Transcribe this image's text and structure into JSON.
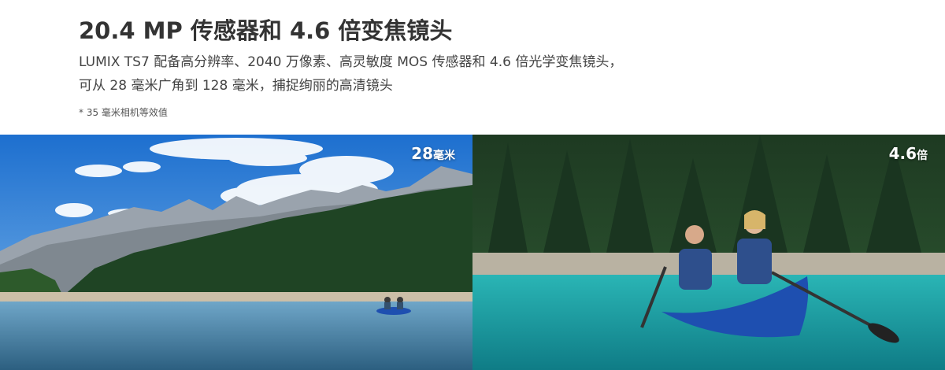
{
  "headline": "20.4 MP 传感器和 4.6 倍变焦镜头",
  "description": {
    "line1": "LUMIX TS7 配备高分辨率、2040 万像素、高灵敏度 MOS 传感器和 4.6 倍光学变焦镜头，",
    "line2": "可从 28 毫米广角到 128 毫米，捕捉绚丽的高清镜头"
  },
  "footnote": "* 35 毫米相机等效值",
  "photos": {
    "wide": {
      "value": "28",
      "unit": "毫米"
    },
    "tele": {
      "value": "4.6",
      "unit": "倍"
    }
  },
  "colors": {
    "sky": "#2f7fd4",
    "lake": "#1fa3a8",
    "canoe": "#1e4fb0",
    "forest": "#234a2a"
  }
}
